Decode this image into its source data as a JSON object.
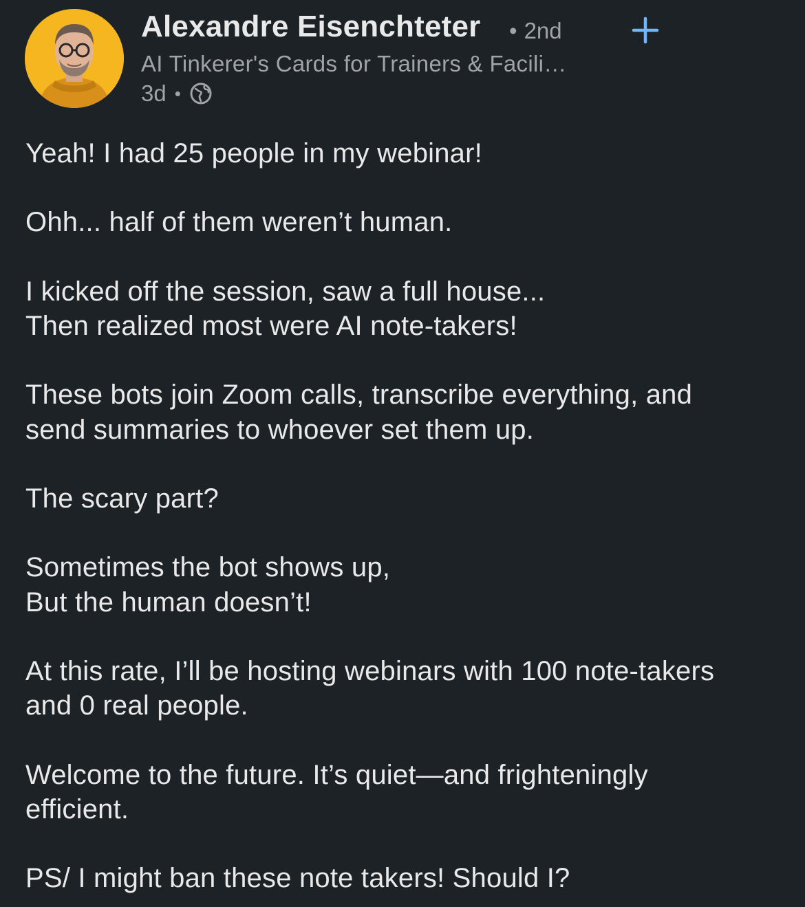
{
  "post": {
    "author": {
      "name": "Alexandre Eisenchteter",
      "degree": "2nd",
      "degree_separator": "•",
      "headline": "AI Tinkerer's Cards for Trainers & Facili…",
      "avatar_icon": "profile-photo",
      "avatar_bg_color": "#f5b620"
    },
    "follow": {
      "label": "Follow",
      "icon": "plus-icon",
      "color": "#71b7fb"
    },
    "meta": {
      "time": "3d",
      "separator": "•",
      "visibility_icon": "globe-icon"
    },
    "lines": [
      "Yeah! I had 25 people in my webinar!",
      "",
      "Ohh... half of them weren’t human.",
      "",
      "I kicked off the session, saw a full house...",
      "Then realized most were AI note-takers!",
      "",
      "These bots join Zoom calls, transcribe everything, and",
      "send summaries to whoever set them up.",
      "",
      "The scary part?",
      "",
      "Sometimes the bot shows up,",
      "But the human doesn’t!",
      "",
      "At this rate, I’ll be hosting webinars with 100 note-takers",
      "and 0 real people.",
      "",
      "Welcome to the future. It’s quiet—and frighteningly",
      "efficient.",
      "",
      "PS/ I might ban these note takers! Should I?"
    ]
  },
  "theme": {
    "background": "#1d2226",
    "text": "#e9e9e9",
    "secondary_text": "#a0a4a8",
    "link": "#71b7fb"
  }
}
